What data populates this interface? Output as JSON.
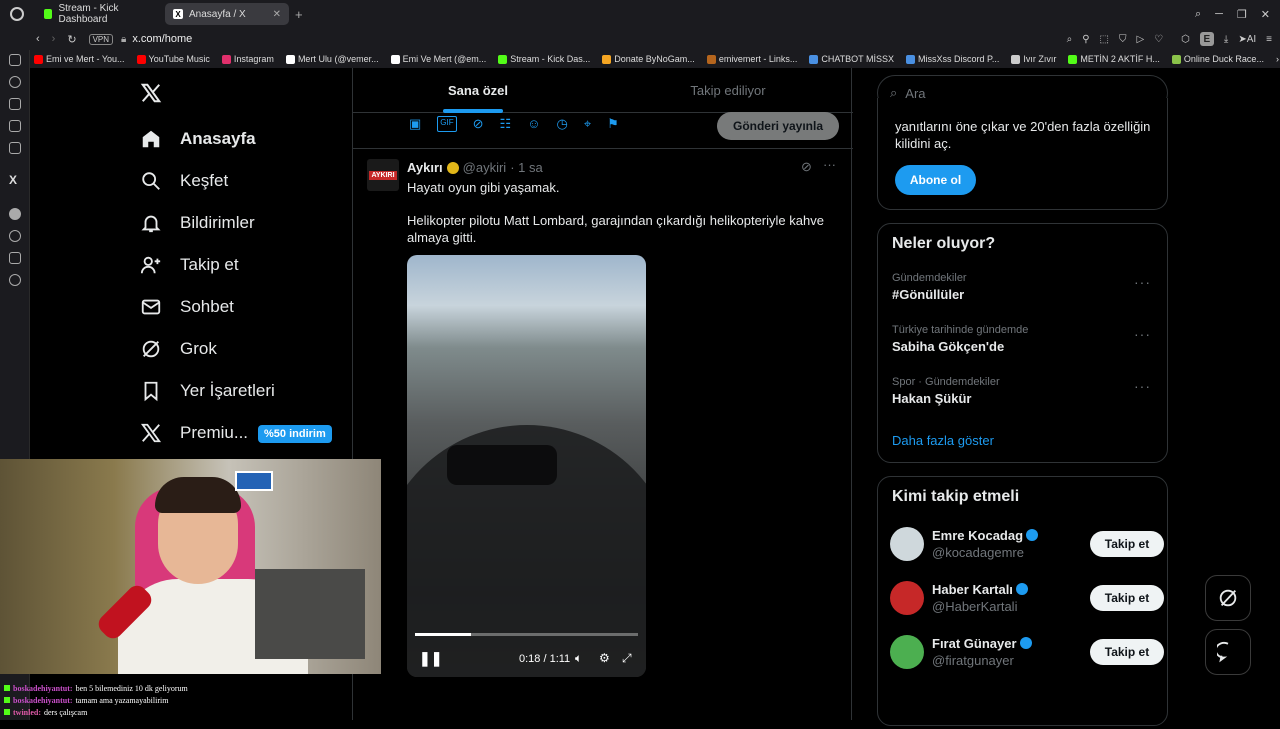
{
  "browser": {
    "tabs": [
      {
        "label": "Stream - Kick Dashboard",
        "favicon_color": "#53fc18"
      },
      {
        "label": "Anasayfa / X",
        "favicon_color": "#ffffff"
      }
    ],
    "vpn_label": "VPN",
    "url": "x.com/home",
    "ai_label": "AI",
    "profile_initial": "E",
    "bookmarks": [
      {
        "label": "Emi ve Mert - You...",
        "color": "#ff0000"
      },
      {
        "label": "YouTube Music",
        "color": "#ff0000"
      },
      {
        "label": "Instagram",
        "color": "#e1306c"
      },
      {
        "label": "Mert Ulu (@vemer...",
        "color": "#ffffff"
      },
      {
        "label": "Emi Ve Mert (@em...",
        "color": "#ffffff"
      },
      {
        "label": "Stream - Kick Das...",
        "color": "#53fc18"
      },
      {
        "label": "Donate ByNoGam...",
        "color": "#f5a623"
      },
      {
        "label": "emivemert - Links...",
        "color": "#b5651d"
      },
      {
        "label": "CHATBOT MİSSX",
        "color": "#4a90e2"
      },
      {
        "label": "MissXss Discord P...",
        "color": "#4a90e2"
      },
      {
        "label": "Ivır Zıvır",
        "color": "#cccccc"
      },
      {
        "label": "METİN 2 AKTİF H...",
        "color": "#53fc18"
      },
      {
        "label": "Online Duck Race...",
        "color": "#8bc34a"
      }
    ]
  },
  "nav": {
    "items": [
      {
        "label": "Anasayfa",
        "icon": "home-icon"
      },
      {
        "label": "Keşfet",
        "icon": "search-icon"
      },
      {
        "label": "Bildirimler",
        "icon": "bell-icon"
      },
      {
        "label": "Takip et",
        "icon": "person-add-icon"
      },
      {
        "label": "Sohbet",
        "icon": "mail-icon"
      },
      {
        "label": "Grok",
        "icon": "grok-icon"
      },
      {
        "label": "Yer İşaretleri",
        "icon": "bookmark-icon"
      },
      {
        "label": "Premiu...",
        "icon": "x-logo-icon"
      }
    ],
    "premium_badge": "%50 indirim"
  },
  "feed": {
    "tabs": [
      "Sana özel",
      "Takip ediliyor"
    ],
    "post_button": "Gönderi yayınla",
    "tweet": {
      "avatar_text": "AYKIRI",
      "author": "Aykırı",
      "handle": "@aykiri",
      "time": "· 1 sa",
      "text1": "Hayatı oyun gibi yaşamak.",
      "text2": "Helikopter pilotu Matt Lombard, garajından çıkardığı helikopteriyle kahve almaya gitti.",
      "video_time": "0:18 / 1:11",
      "video_progress": 0.25
    }
  },
  "right": {
    "search_placeholder": "Ara",
    "premium_text": "yanıtlarını öne çıkar ve 20'den fazla özelliğin kilidini aç.",
    "subscribe_button": "Abone ol",
    "trends_title": "Neler oluyor?",
    "trends": [
      {
        "category": "Gündemdekiler",
        "name": "#Gönüllüler"
      },
      {
        "category": "Türkiye tarihinde gündemde",
        "name": "Sabiha Gökçen'de"
      },
      {
        "category": "Spor · Gündemdekiler",
        "name": "Hakan Şükür"
      }
    ],
    "show_more": "Daha fazla göster",
    "who_to_follow_title": "Kimi takip etmeli",
    "follow_button": "Takip et",
    "suggestions": [
      {
        "name": "Emre Kocadag",
        "handle": "@kocadagemre",
        "color": "#cfd8dc"
      },
      {
        "name": "Haber Kartalı",
        "handle": "@HaberKartali",
        "color": "#c62828"
      },
      {
        "name": "Fırat Günayer",
        "handle": "@firatgunayer",
        "color": "#4caf50"
      }
    ]
  },
  "chat": [
    {
      "user": "boskadehiyantut:",
      "message": "ben 5 bilemediniz 10 dk geliyorum",
      "color": "#c94fc9"
    },
    {
      "user": "boskadehiyantut:",
      "message": "tamam ama yazamayabilirim",
      "color": "#c94fc9"
    },
    {
      "user": "twinled:",
      "message": "ders çalışcam",
      "color": "#e05aa8"
    }
  ]
}
